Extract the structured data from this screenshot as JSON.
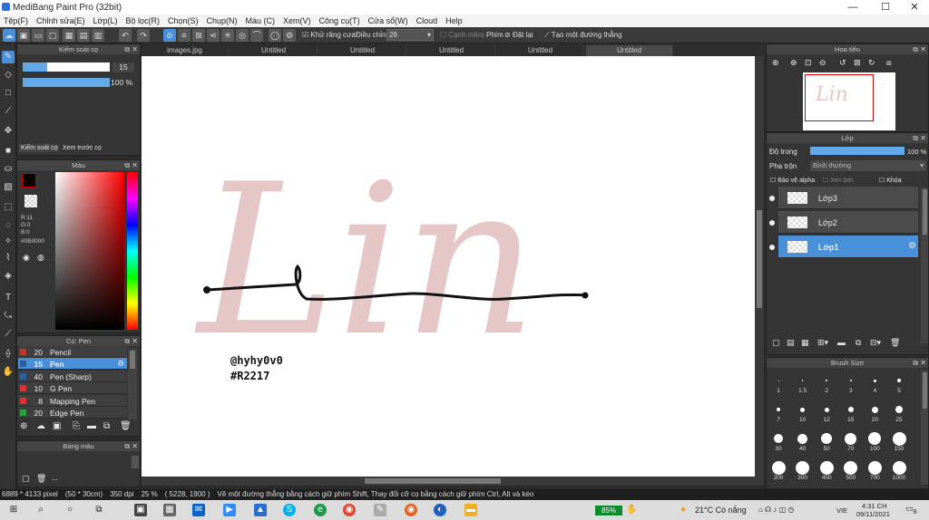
{
  "window": {
    "title": "MediBang Paint Pro (32bit)",
    "min": "—",
    "max": "☐",
    "close": "✕"
  },
  "menu": [
    "Tệp(F)",
    "Chỉnh sửa(E)",
    "Lớp(L)",
    "Bộ lọc(R)",
    "Chọn(S)",
    "Chụp(N)",
    "Màu (C)",
    "Xem(V)",
    "Công cụ(T)",
    "Cửa sổ(W)",
    "Cloud",
    "Help"
  ],
  "toolbar": {
    "antialias": "Khử răng cưa",
    "adjust_label": "Điều chỉnh",
    "adjust_value": "28",
    "smooth": "Cạnh mềm",
    "key_label": "Phím",
    "reset": "Đặt lại",
    "straight_line": "Tạo một đường thẳng"
  },
  "tabs": [
    "images.jpg",
    "Untitled",
    "Untitled",
    "Untitled",
    "Untitled",
    "Untitled"
  ],
  "brush_control": {
    "title": "Kiểm soát cọ",
    "size": "15",
    "opacity": "100 %",
    "tab1": "Kiểm soát cọ",
    "tab2": "Xem trước cọ"
  },
  "color": {
    "title": "Màu",
    "r": "R:11",
    "g": "G:0",
    "b": "B:0",
    "hex": "#0B0000",
    "fg": "#0b0000"
  },
  "brushes": {
    "title": "Cọ: Pen",
    "items": [
      {
        "size": "20",
        "name": "Pencil",
        "color": "#c0392b"
      },
      {
        "size": "15",
        "name": "Pen",
        "color": "#2b5e9e"
      },
      {
        "size": "40",
        "name": "Pen (Sharp)",
        "color": "#2b5e9e"
      },
      {
        "size": "10",
        "name": "G Pen",
        "color": "#e03030"
      },
      {
        "size": "8",
        "name": "Mapping Pen",
        "color": "#e03030"
      },
      {
        "size": "20",
        "name": "Edge Pen",
        "color": "#2ea043"
      }
    ]
  },
  "palette": {
    "title": "Bảng màu",
    "dots": "..."
  },
  "navigator": {
    "title": "Hoa tiêu"
  },
  "layers": {
    "title": "Lớp",
    "opacity_label": "Độ trong",
    "opacity_value": "100 %",
    "blend_label": "Pha trộn",
    "blend_value": "Bình thường",
    "protect_alpha": "Bảo vệ alpha",
    "clip": "Xén bớt",
    "lock": "Khóa",
    "items": [
      "Lớp3",
      "Lớp2",
      "Lớp1"
    ]
  },
  "brush_size": {
    "title": "Brush Size",
    "sizes": [
      "1",
      "1.5",
      "2",
      "3",
      "4",
      "5",
      "7",
      "10",
      "12",
      "15",
      "20",
      "25",
      "30",
      "40",
      "50",
      "70",
      "100",
      "150",
      "200",
      "300",
      "400",
      "500",
      "700",
      "1000"
    ]
  },
  "canvas": {
    "text": "Lin",
    "watermark_line1": "@hyhy0v0",
    "watermark_line2": "#R2217"
  },
  "status": {
    "dims": "6889 * 4133 pixel",
    "cm": "(50 * 30cm)",
    "dpi": "350 dpi",
    "zoom": "25 %",
    "coords": "( 5228, 1900 )",
    "hint": "Vẽ một đường thẳng bằng cách giữ phím Shift, Thay đổi cỡ cọ bằng cách giữ phím Ctrl, Alt và kéo"
  },
  "taskbar": {
    "battery": "85%",
    "weather": "21°C Có nắng",
    "lang": "VIE",
    "time": "4:31 CH",
    "date": "09/11/2021",
    "notif": "6"
  }
}
